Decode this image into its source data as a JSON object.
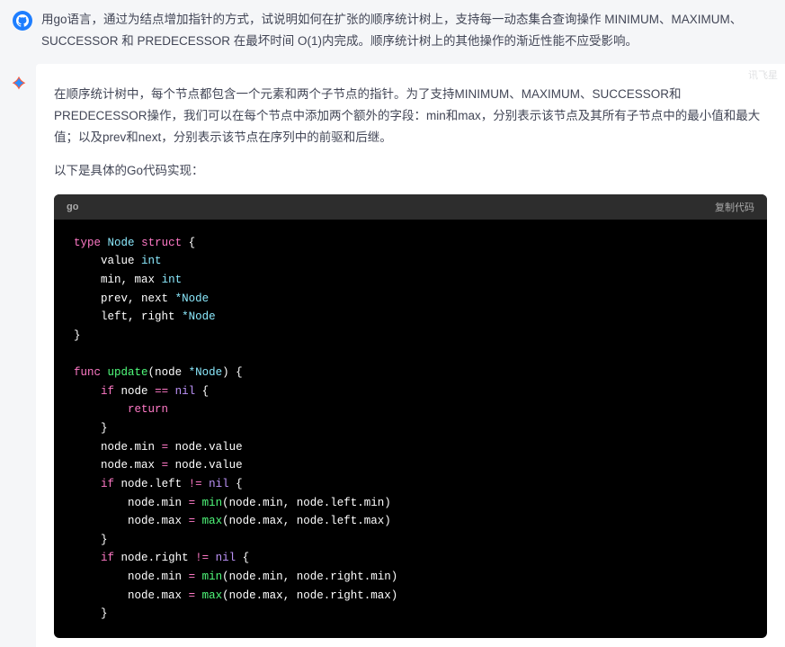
{
  "user": {
    "prompt": "用go语言，通过为结点增加指针的方式，试说明如何在扩张的顺序统计树上，支持每一动态集合查询操作 MINIMUM、MAXIMUM、SUCCESSOR 和 PREDECESSOR 在最坏时间 O(1)内完成。顺序统计树上的其他操作的渐近性能不应受影响。"
  },
  "watermark": "讯飞星",
  "assistant": {
    "para1": "在顺序统计树中，每个节点都包含一个元素和两个子节点的指针。为了支持MINIMUM、MAXIMUM、SUCCESSOR和PREDECESSOR操作，我们可以在每个节点中添加两个额外的字段：min和max，分别表示该节点及其所有子节点中的最小值和最大值；以及prev和next，分别表示该节点在序列中的前驱和后继。",
    "para2": "以下是具体的Go代码实现："
  },
  "code": {
    "lang": "go",
    "copy_label": "复制代码",
    "tokens": {
      "type": "type",
      "node": "Node",
      "struct": "struct",
      "value": "value",
      "int": "int",
      "min": "min",
      "max": "max",
      "prev": "prev",
      "next": "next",
      "star_node": "*Node",
      "left": "left",
      "right": "right",
      "func": "func",
      "update": "update",
      "node_param": "node",
      "if": "if",
      "eq": "==",
      "nil": "nil",
      "return": "return",
      "assign": "=",
      "neq": "!=",
      "min_fn": "min",
      "max_fn": "max"
    }
  }
}
